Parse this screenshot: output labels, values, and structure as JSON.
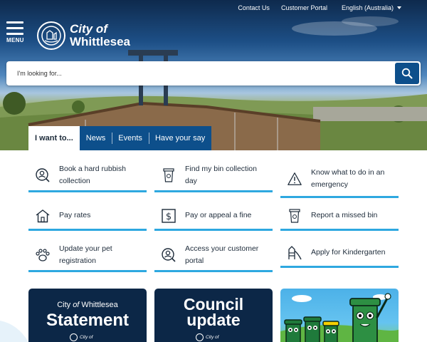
{
  "topbar": {
    "contact": "Contact Us",
    "portal": "Customer Portal",
    "language": "English (Australia)"
  },
  "menu": {
    "label": "MENU"
  },
  "logo": {
    "line1": "City of",
    "line2": "Whittlesea"
  },
  "search": {
    "placeholder": "I'm looking for..."
  },
  "tabs": [
    {
      "label": "I want to..."
    },
    {
      "label": "News"
    },
    {
      "label": "Events"
    },
    {
      "label": "Have your say"
    }
  ],
  "quick_links": [
    {
      "label1": "Book a hard rubbish",
      "label2": "collection",
      "icon": "person-search-icon"
    },
    {
      "label1": "Find my bin collection",
      "label2": "day",
      "icon": "bin-icon"
    },
    {
      "label1": "Know what to do in an",
      "label2": "emergency",
      "icon": "warning-icon"
    },
    {
      "label1": "Pay rates",
      "icon": "house-icon"
    },
    {
      "label1": "Pay or appeal a fine",
      "icon": "dollar-icon"
    },
    {
      "label1": "Report a missed bin",
      "icon": "bin-icon"
    },
    {
      "label1": "Update your pet",
      "label2": "registration",
      "icon": "paw-icon"
    },
    {
      "label1": "Access your customer",
      "label2": "portal",
      "icon": "person-search-icon"
    },
    {
      "label1": "Apply for Kindergarten",
      "icon": "playground-icon"
    }
  ],
  "cards": [
    {
      "small_a": "City ",
      "small_b": "of",
      "small_c": " Whittlesea",
      "big": "Statement",
      "logo_text": "City of"
    },
    {
      "big1": "Council",
      "big2": "update",
      "logo_text": "City of"
    }
  ],
  "colors": {
    "primary": "#0d4f8b",
    "accent": "#2ea8e0",
    "navy": "#0c2747"
  }
}
